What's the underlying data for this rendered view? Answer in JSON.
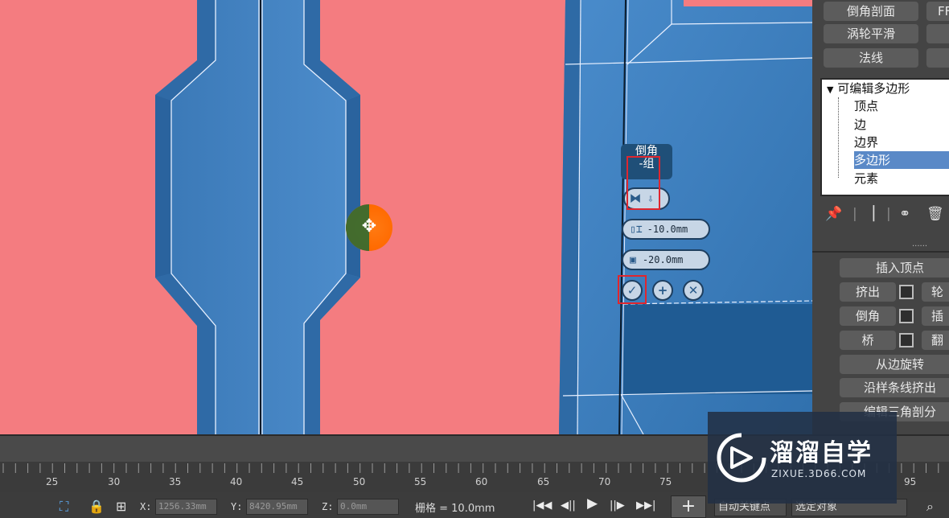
{
  "caddy": {
    "title_line1": "倒角",
    "title_line2": "-组",
    "height_value": "-10.0mm",
    "outline_value": "-20.0mm",
    "ok_icon": "check-icon",
    "apply_icon": "plus-icon",
    "cancel_icon": "close-icon"
  },
  "right_panel": {
    "top_buttons": [
      "倒角剖面",
      "FF",
      "涡轮平滑",
      "法线"
    ],
    "modifier_stack": {
      "root": "可编辑多边形",
      "items": [
        "顶点",
        "边",
        "边界",
        "多边形",
        "元素"
      ],
      "selected_index": 3
    },
    "edit_buttons": {
      "insert_vertex": "插入顶点",
      "extrude": "挤出",
      "outline_partial": "轮",
      "bevel": "倒角",
      "inset_partial": "插",
      "bridge": "桥",
      "flip_partial": "翻",
      "hinge_from_edge": "从边旋转",
      "extrude_along_spline": "沿样条线挤出",
      "edit_triangulation": "编辑三角剖分"
    },
    "separator": "......"
  },
  "ruler": {
    "labels": [
      "25",
      "30",
      "35",
      "40",
      "45",
      "50",
      "55",
      "60",
      "65",
      "70",
      "75",
      "95"
    ]
  },
  "status": {
    "x_label": "X:",
    "x_value": "1256.33mm",
    "y_label": "Y:",
    "y_value": "8420.95mm",
    "z_label": "Z:",
    "z_value": "0.0mm",
    "grid_text": "栅格 = 10.0mm",
    "auto_key": "自动关键点",
    "selected_object": "选定对象"
  },
  "watermark": {
    "brand": "溜溜自学",
    "url": "ZIXUE.3D66.COM"
  },
  "colors": {
    "viewport_pink": "#f47c80",
    "model_blue": "#3f7fbd",
    "selection_blue": "#5a89c7",
    "highlight_red": "#e0262e",
    "gizmo_orange": "#ff6a00"
  }
}
